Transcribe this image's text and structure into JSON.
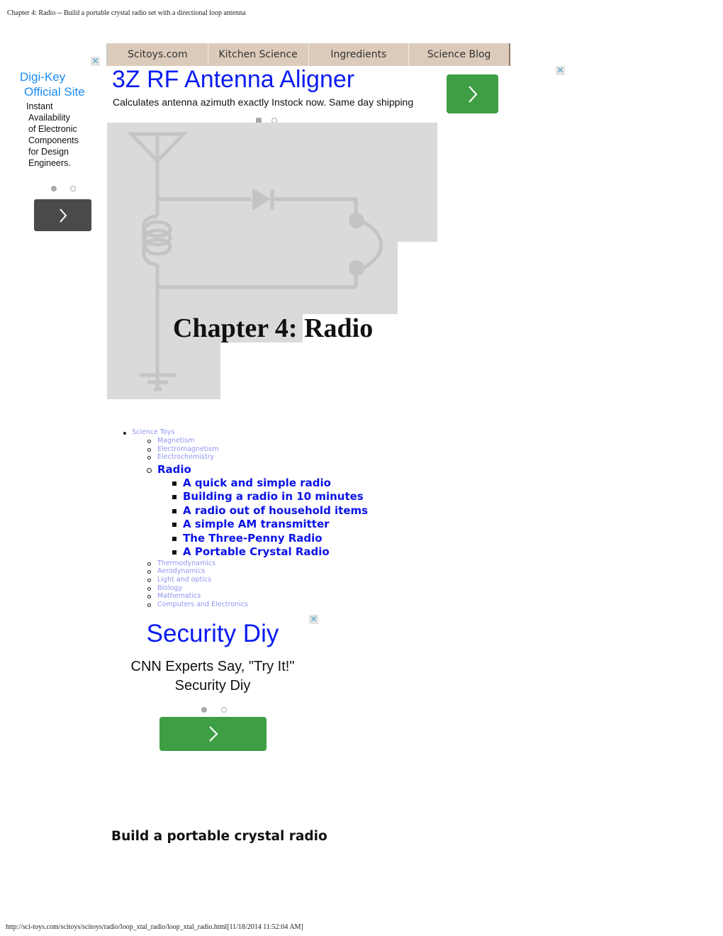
{
  "print_header": {
    "title": "Chapter 4: Radio -- Build a portable crystal radio set with a directional loop antenna"
  },
  "print_footer": {
    "url_and_timestamp": "http://sci-toys.com/scitoys/scitoys/radio/loop_xtal_radio/loop_xtal_radio.html[11/18/2014 11:52:04 AM]"
  },
  "nav": {
    "tabs": [
      {
        "label": "Scitoys.com"
      },
      {
        "label": "Kitchen Science"
      },
      {
        "label": "Ingredients"
      },
      {
        "label": "Science Blog"
      }
    ]
  },
  "ads": {
    "left": {
      "title_line1": "Digi-Key",
      "title_line2": "Official Site",
      "body_lines": [
        "Instant",
        "Availability",
        "of Electronic",
        "Components",
        "for Design",
        "Engineers."
      ],
      "close_icon": "close-x-icon",
      "next_icon": "chevron-right-icon",
      "carousel": {
        "count": 2,
        "active_index": 0
      }
    },
    "top": {
      "title": "3Z RF Antenna Aligner",
      "description": "Calculates antenna azimuth exactly Instock now. Same day shipping",
      "close_icon": "close-x-icon",
      "next_icon": "chevron-right-icon",
      "carousel": {
        "count": 2,
        "active_index": 0
      }
    },
    "bottom": {
      "title": "Security Diy",
      "description_line1": "CNN Experts Say, \"Try It!\"",
      "description_line2": "Security Diy",
      "close_icon": "close-x-icon",
      "next_icon": "chevron-right-icon",
      "carousel": {
        "count": 2,
        "active_index": 0
      }
    },
    "colors": {
      "green_button": "#3d9e44",
      "dark_button": "#4a4a4a",
      "ad_title_blue": "#0a1cf0",
      "ad_title_light_blue": "#1a8cf0"
    }
  },
  "hero": {
    "heading": "Chapter 4: Radio",
    "image_description": "crystal radio schematic with antenna, coil, diode, earphone and ground"
  },
  "navigation_tree": {
    "root": "Science Toys",
    "before_current": [
      "Magnetism",
      "Electromagnetism",
      "Electrochemistry"
    ],
    "current": "Radio",
    "current_children": [
      "A quick and simple radio",
      "Building a radio in 10 minutes",
      "A radio out of household items",
      "A simple AM transmitter",
      "The Three-Penny Radio",
      "A Portable Crystal Radio"
    ],
    "after_current": [
      "Thermodynamics",
      "Aerodynamics",
      "Light and optics",
      "Biology",
      "Mathematics",
      "Computers and Electronics"
    ]
  },
  "main": {
    "section_heading": "Build a portable crystal radio"
  },
  "colors": {
    "nav_bg": "#dccbbb",
    "link_visited": "#8f96f0",
    "link_strong": "#0a12e6"
  }
}
